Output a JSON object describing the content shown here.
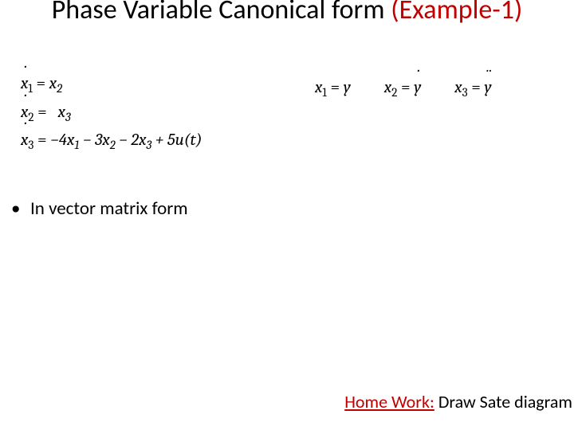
{
  "title": {
    "main": "Phase Variable Canonical form ",
    "accent": "(Example-1)"
  },
  "equations": {
    "sysdot": [
      {
        "lhs_var": "x",
        "lhs_sub": "1",
        "rhs_html": "x<span class='sub'>2</span>"
      },
      {
        "lhs_var": "x",
        "lhs_sub": "2",
        "rhs_html": "x<span class='sub'>3</span>"
      },
      {
        "lhs_var": "x",
        "lhs_sub": "3",
        "rhs_html": "−4x<span class='sub'>1</span> − 3x<span class='sub'>2</span> − 2x<span class='sub'>3</span> + 5u(t)"
      }
    ],
    "defs": [
      {
        "lhs_var": "x",
        "lhs_sub": "1",
        "rhs_class": "",
        "rhs_var": "y"
      },
      {
        "lhs_var": "x",
        "lhs_sub": "2",
        "rhs_class": "dot-over",
        "rhs_var": "y"
      },
      {
        "lhs_var": "x",
        "lhs_sub": "3",
        "rhs_class": "ddot-over",
        "rhs_var": "y"
      }
    ]
  },
  "bullets": {
    "vector_matrix": "In vector matrix form"
  },
  "homework": {
    "label": "Home Work:",
    "text": " Draw Sate diagram"
  }
}
